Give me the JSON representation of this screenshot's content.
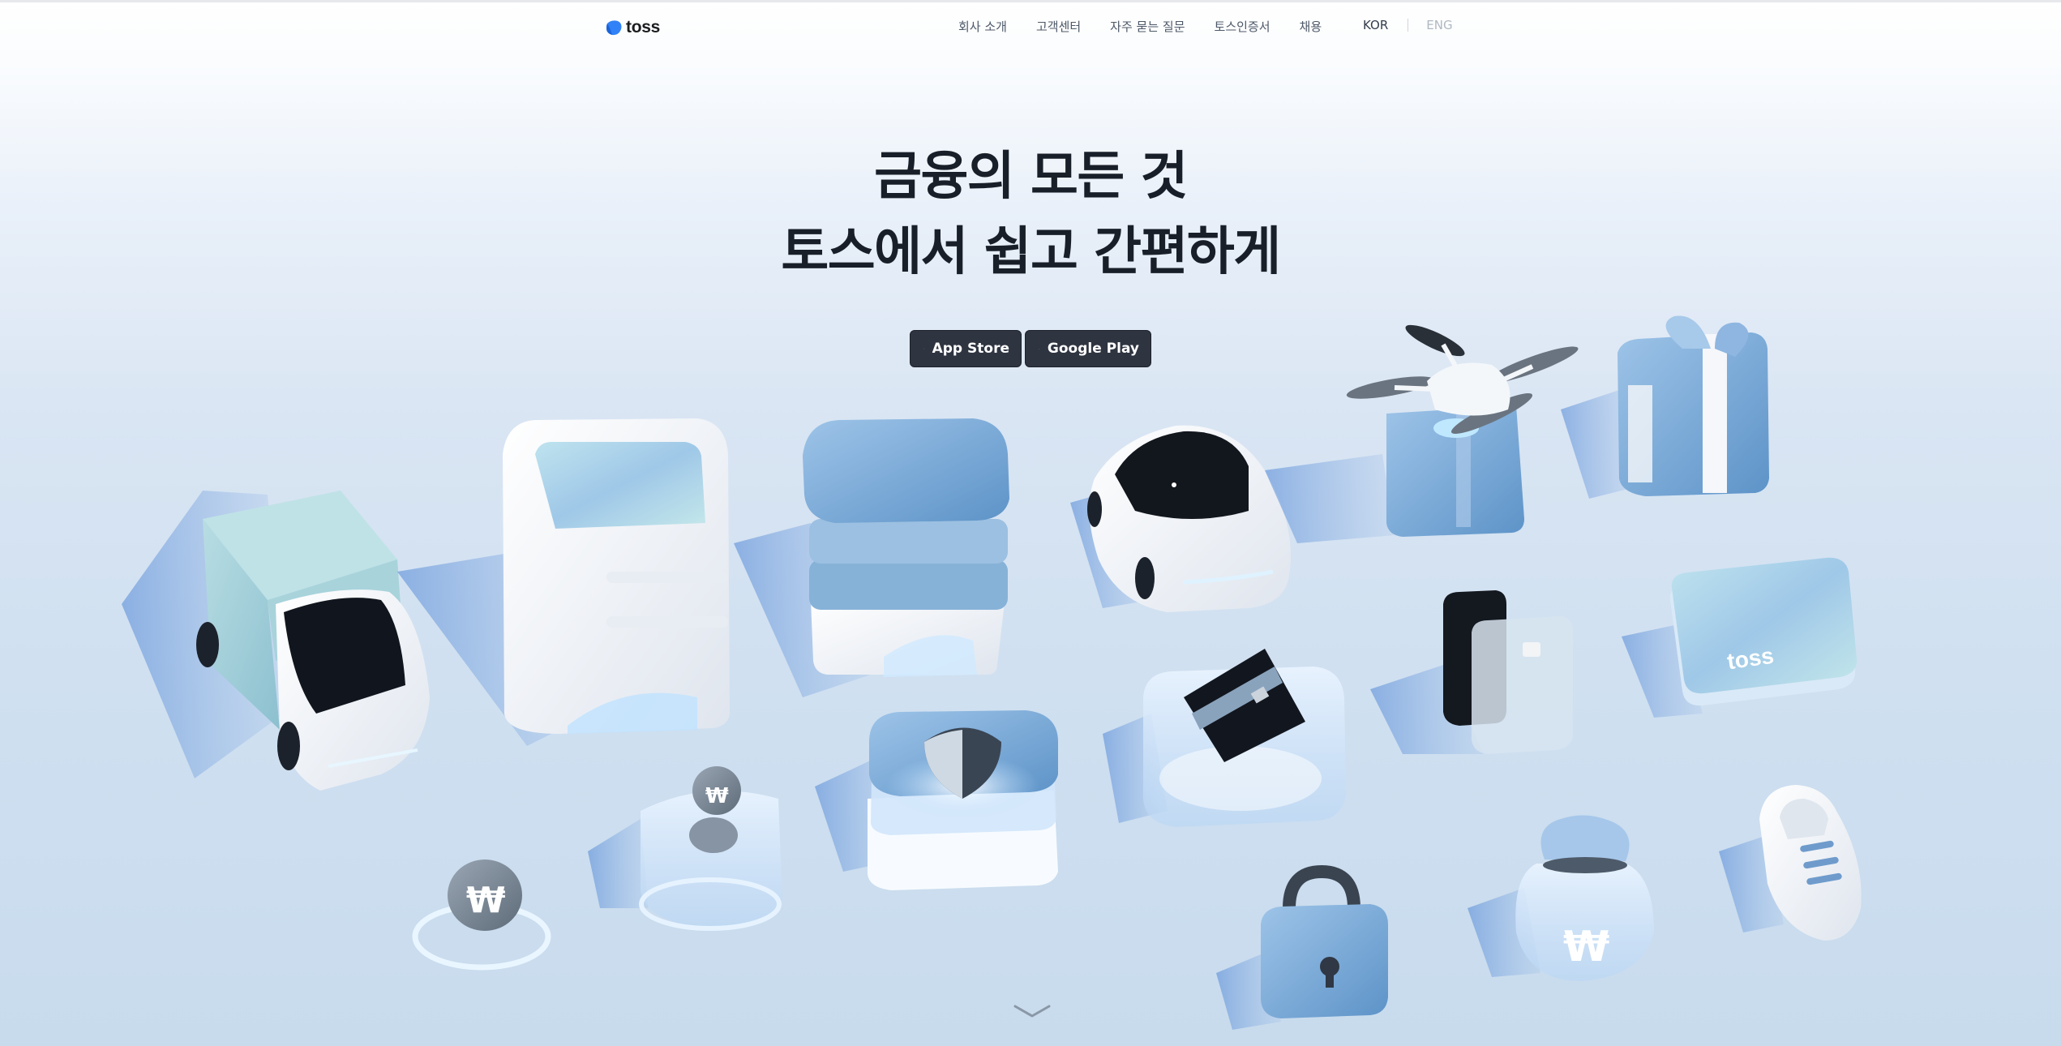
{
  "brand": {
    "name": "toss",
    "primary_color": "#3182f6",
    "text_color": "#191f28"
  },
  "header": {
    "logo_text": "toss",
    "nav": [
      {
        "label": "회사 소개"
      },
      {
        "label": "고객센터"
      },
      {
        "label": "자주 묻는 질문"
      },
      {
        "label": "토스인증서"
      },
      {
        "label": "채용"
      }
    ],
    "lang": {
      "kor": "KOR",
      "eng": "ENG",
      "selected": "KOR"
    }
  },
  "hero": {
    "title_line1": "금융의 모든 것",
    "title_line2": "토스에서 쉽고 간편하게",
    "app_store_label": "App Store",
    "google_play_label": "Google Play",
    "card_logo_text": "toss",
    "coin_symbol": "₩"
  },
  "icons": {
    "scroll_down": "chevron-down-icon",
    "apple": "apple-icon",
    "google_play": "google-play-icon"
  }
}
